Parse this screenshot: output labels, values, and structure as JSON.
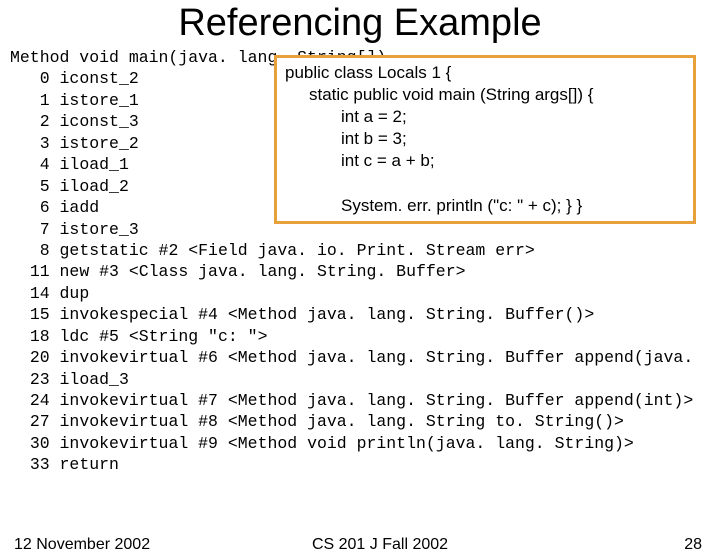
{
  "title": "Referencing Example",
  "bytecode": {
    "header": "Method void main(java. lang. String[])",
    "lines": [
      {
        "offset": "0",
        "instr": "iconst_2"
      },
      {
        "offset": "1",
        "instr": "istore_1"
      },
      {
        "offset": "2",
        "instr": "iconst_3"
      },
      {
        "offset": "3",
        "instr": "istore_2"
      },
      {
        "offset": "4",
        "instr": "iload_1"
      },
      {
        "offset": "5",
        "instr": "iload_2"
      },
      {
        "offset": "6",
        "instr": "iadd"
      },
      {
        "offset": "7",
        "instr": "istore_3"
      },
      {
        "offset": "8",
        "instr": "getstatic #2 <Field java. io. Print. Stream err>"
      },
      {
        "offset": "11",
        "instr": "new #3 <Class java. lang. String. Buffer>"
      },
      {
        "offset": "14",
        "instr": "dup"
      },
      {
        "offset": "15",
        "instr": "invokespecial #4 <Method java. lang. String. Buffer()>"
      },
      {
        "offset": "18",
        "instr": "ldc #5 <String \"c: \">"
      },
      {
        "offset": "20",
        "instr": "invokevirtual #6 <Method java. lang. String. Buffer append(java."
      },
      {
        "offset": "23",
        "instr": "iload_3"
      },
      {
        "offset": "24",
        "instr": "invokevirtual #7 <Method java. lang. String. Buffer append(int)>"
      },
      {
        "offset": "27",
        "instr": "invokevirtual #8 <Method java. lang. String to. String()>"
      },
      {
        "offset": "30",
        "instr": "invokevirtual #9 <Method void println(java. lang. String)>"
      },
      {
        "offset": "33",
        "instr": "return"
      }
    ]
  },
  "source": {
    "line1": "public class Locals 1 {",
    "line2": "static public void main (String args[]) {",
    "line3": "int a = 2;",
    "line4": "int b = 3;",
    "line5": "int c = a + b;",
    "line7": "System. err. println (\"c: \" + c); } }"
  },
  "footer": {
    "date": "12 November 2002",
    "course": "CS 201 J Fall 2002",
    "page": "28"
  }
}
